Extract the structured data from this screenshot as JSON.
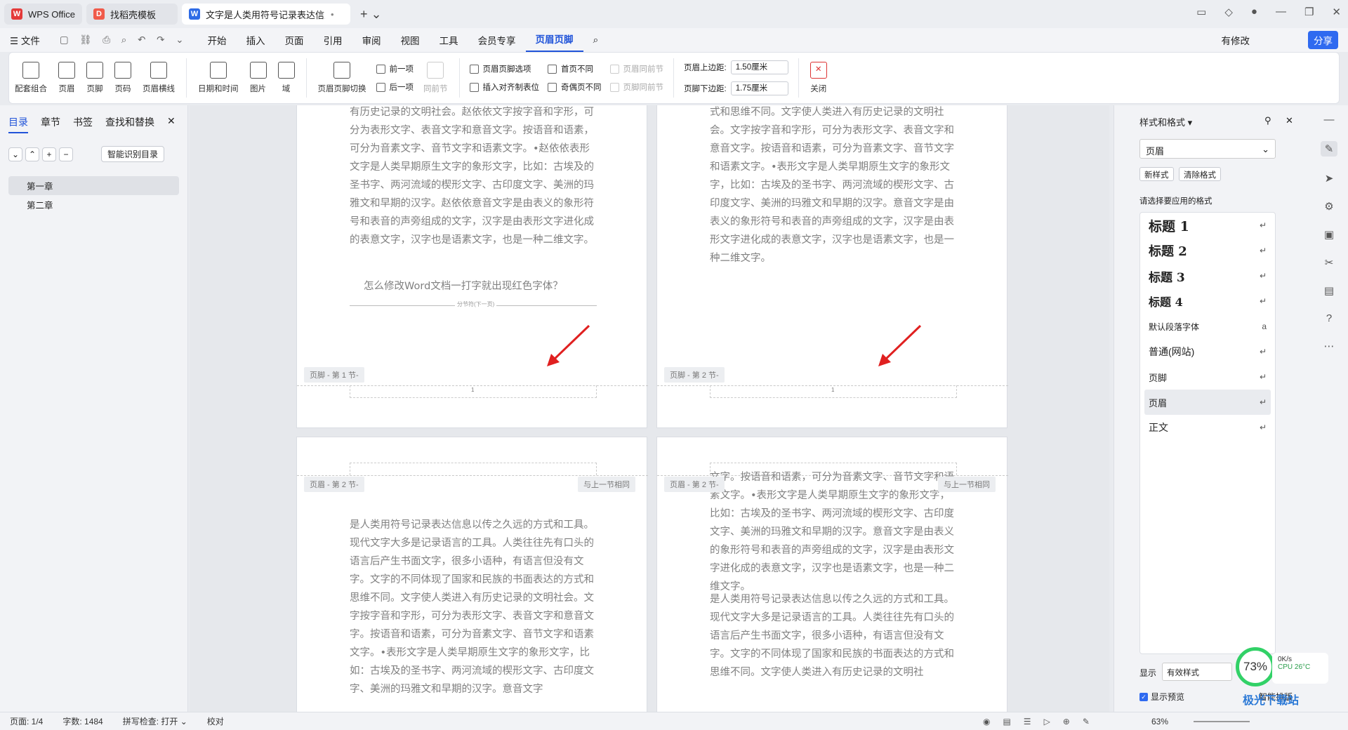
{
  "tabs": [
    {
      "label": "WPS Office",
      "icon": "wps-logo-icon"
    },
    {
      "label": "找稻壳模板",
      "icon": "docer-icon"
    },
    {
      "label": "文字是人类用符号记录表达信息以",
      "icon": "word-doc-icon"
    }
  ],
  "menu": {
    "file": "文件",
    "items": [
      "开始",
      "插入",
      "页面",
      "引用",
      "审阅",
      "视图",
      "工具",
      "会员专享",
      "页眉页脚"
    ],
    "active_index": 8,
    "modified": "有修改",
    "share": "分享"
  },
  "ribbon": {
    "big": [
      "配套组合",
      "页眉",
      "页脚",
      "页码",
      "页眉横线",
      "日期和时间",
      "图片",
      "域",
      "页眉页脚切换"
    ],
    "small1": [
      "前一项",
      "后一项",
      "同前节"
    ],
    "small2": [
      "页眉页脚选项",
      "插入对齐制表位"
    ],
    "checks": [
      "首页不同",
      "奇偶页不同"
    ],
    "disabled": [
      "页眉同前节",
      "页脚同前节"
    ],
    "top_margin_label": "页眉上边距:",
    "top_margin_value": "1.50厘米",
    "bottom_margin_label": "页脚下边距:",
    "bottom_margin_value": "1.75厘米",
    "close": "关闭"
  },
  "left": {
    "tabs": [
      "目录",
      "章节",
      "书签",
      "查找和替换"
    ],
    "smart": "智能识别目录",
    "items": [
      "第一章",
      "第二章"
    ]
  },
  "doc": {
    "p1_text": "有历史记录的文明社会。赵依依文字按字音和字形，可分为表形文字、表音文字和意音文字。按语音和语素，可分为音素文字、音节文字和语素文字。•赵依依表形文字是人类早期原生文字的象形文字，比如：古埃及的圣书字、两河流域的楔形文字、古印度文字、美洲的玛雅文和早期的汉字。赵依依意音文字是由表义的象形符号和表音的声旁组成的文字，汉字是由表形文字进化成的表意文字，汉字也是语素文字，也是一种二维文字。",
    "p1_question": "怎么修改Word文档一打字就出现红色字体？",
    "p1_break": "分节符(下一页)",
    "p2_text": "式和思维不同。文字使人类进入有历史记录的文明社会。文字按字音和字形，可分为表形文字、表音文字和意音文字。按语音和语素，可分为音素文字、音节文字和语素文字。•表形文字是人类早期原生文字的象形文字，比如：古埃及的圣书字、两河流域的楔形文字、古印度文字、美洲的玛雅文和早期的汉字。意音文字是由表义的象形符号和表音的声旁组成的文字，汉字是由表形文字进化成的表意文字，汉字也是语素文字，也是一种二维文字。",
    "footer1": "页脚 - 第 1 节-",
    "footer2": "页脚 - 第 2 节-",
    "page_num": "1",
    "header3": "页眉 - 第 2 节-",
    "header4": "页眉 - 第 2 节-",
    "same_prev": "与上一节相同",
    "p3_text": "是人类用符号记录表达信息以传之久远的方式和工具。现代文字大多是记录语言的工具。人类往往先有口头的语言后产生书面文字，很多小语种，有语言但没有文字。文字的不同体现了国家和民族的书面表达的方式和思维不同。文字使人类进入有历史记录的文明社会。文字按字音和字形，可分为表形文字、表音文字和意音文字。按语音和语素，可分为音素文字、音节文字和语素文字。•表形文字是人类早期原生文字的象形文字，比如：古埃及的圣书字、两河流域的楔形文字、古印度文字、美洲的玛雅文和早期的汉字。意音文字",
    "p4_text": "文字。按语音和语素，可分为音素文字、音节文字和语素文字。•表形文字是人类早期原生文字的象形文字，比如：古埃及的圣书字、两河流域的楔形文字、古印度文字、美洲的玛雅文和早期的汉字。意音文字是由表义的象形符号和表音的声旁组成的文字，汉字是由表形文字进化成的表意文字，汉字也是语素文字，也是一种二维文字。",
    "p4_text2": "是人类用符号记录表达信息以传之久远的方式和工具。现代文字大多是记录语言的工具。人类往往先有口头的语言后产生书面文字，很多小语种，有语言但没有文字。文字的不同体现了国家和民族的书面表达的方式和思维不同。文字使人类进入有历史记录的文明社"
  },
  "right": {
    "title": "样式和格式",
    "current": "页眉",
    "new": "新样式",
    "clear": "清除格式",
    "prompt": "请选择要应用的格式",
    "styles": [
      {
        "name": "标题  1",
        "big": true
      },
      {
        "name": "标题  2",
        "big": true
      },
      {
        "name": "标题  3",
        "big": true
      },
      {
        "name": "标题  4",
        "big": true
      },
      {
        "name": "默认段落字体"
      },
      {
        "name": "普通(网站)"
      },
      {
        "name": "页脚"
      },
      {
        "name": "页眉",
        "selected": true
      },
      {
        "name": "正文"
      }
    ],
    "show_label": "显示",
    "show_value": "有效样式",
    "preview": "显示预览",
    "smart_layout": "智能排版"
  },
  "status": {
    "page": "页面: 1/4",
    "words": "字数: 1484",
    "spell": "拼写检查: 打开",
    "proof": "校对",
    "zoom": "63%"
  },
  "overlay": {
    "gauge": "73%",
    "net": "0K/s",
    "cpu": "CPU 26°C",
    "brand": "极光下载站"
  }
}
